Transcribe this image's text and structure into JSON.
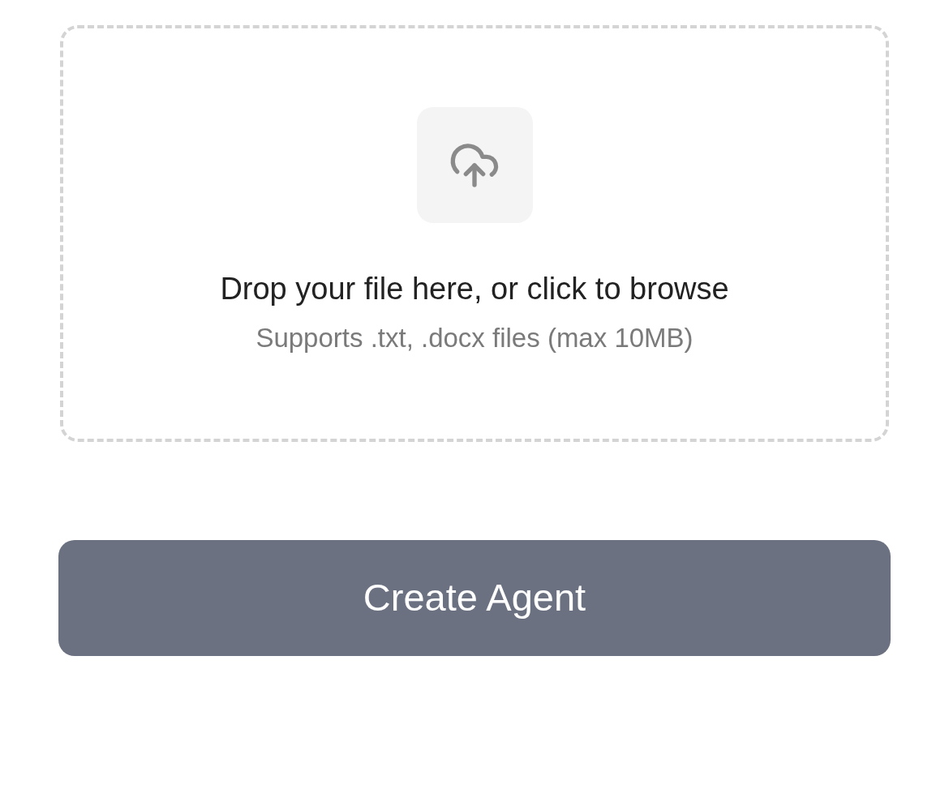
{
  "upload": {
    "title": "Drop your file here, or click to browse",
    "hint": "Supports .txt, .docx files (max 10MB)"
  },
  "create_button": {
    "label": "Create Agent"
  }
}
